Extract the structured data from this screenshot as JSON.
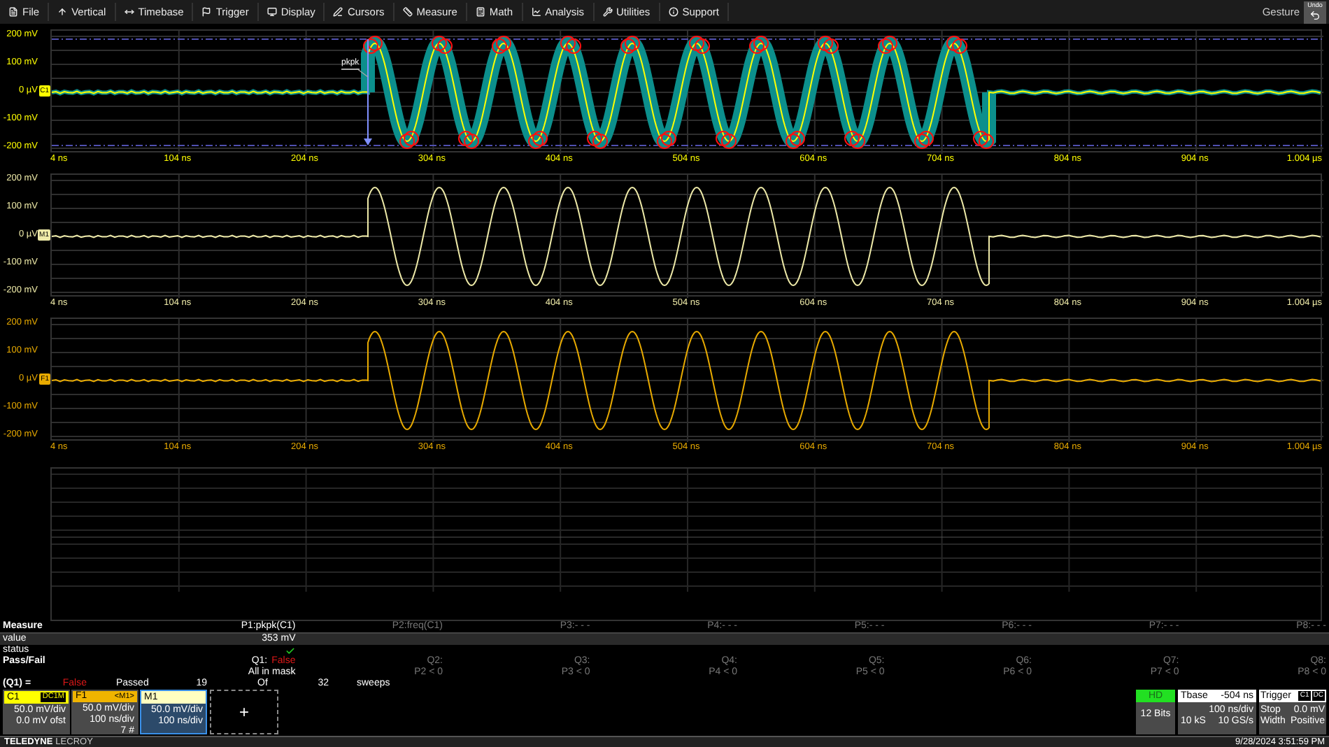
{
  "menu": [
    {
      "label": "File"
    },
    {
      "label": "Vertical"
    },
    {
      "label": "Timebase"
    },
    {
      "label": "Trigger"
    },
    {
      "label": "Display"
    },
    {
      "label": "Cursors"
    },
    {
      "label": "Measure"
    },
    {
      "label": "Math"
    },
    {
      "label": "Analysis"
    },
    {
      "label": "Utilities"
    },
    {
      "label": "Support"
    }
  ],
  "gesture": "Gesture",
  "undo": "Undo",
  "grids": [
    {
      "kind": "mask",
      "tag": "C1",
      "color": "#ffff00",
      "annotation": "pkpk",
      "y_labels": [
        "200 mV",
        "100 mV",
        "0 µV",
        "-100 mV",
        "-200 mV"
      ],
      "x_labels": [
        "4 ns",
        "104 ns",
        "204 ns",
        "304 ns",
        "404 ns",
        "504 ns",
        "604 ns",
        "704 ns",
        "804 ns",
        "904 ns",
        "1.004 µs"
      ]
    },
    {
      "kind": "trace",
      "tag": "M1",
      "color": "#eeeaa8",
      "y_labels": [
        "200 mV",
        "100 mV",
        "0 µV",
        "-100 mV",
        "-200 mV"
      ],
      "x_labels": [
        "4 ns",
        "104 ns",
        "204 ns",
        "304 ns",
        "404 ns",
        "504 ns",
        "604 ns",
        "704 ns",
        "804 ns",
        "904 ns",
        "1.004 µs"
      ]
    },
    {
      "kind": "trace",
      "tag": "F1",
      "color": "#e8aa00",
      "y_labels": [
        "200 mV",
        "100 mV",
        "0 µV",
        "-100 mV",
        "-200 mV"
      ],
      "x_labels": [
        "4 ns",
        "104 ns",
        "204 ns",
        "304 ns",
        "404 ns",
        "504 ns",
        "604 ns",
        "704 ns",
        "804 ns",
        "904 ns",
        "1.004 µs"
      ]
    },
    {
      "kind": "empty"
    }
  ],
  "measure": {
    "title": "Measure",
    "row_labels": [
      "value",
      "status",
      "Pass/Fail"
    ],
    "params": [
      {
        "label": "P1:pkpk(C1)",
        "active": true,
        "value": "353 mV",
        "status_ok": true,
        "q_label": "Q1:",
        "q_result": "False",
        "q_condition": "All in mask"
      },
      {
        "label": "P2:freq(C1)",
        "active": false,
        "q_label": "Q2:",
        "q_condition": "P2 < 0"
      },
      {
        "label": "P3:- - -",
        "active": false,
        "q_label": "Q3:",
        "q_condition": "P3 < 0"
      },
      {
        "label": "P4:- - -",
        "active": false,
        "q_label": "Q4:",
        "q_condition": "P4 < 0"
      },
      {
        "label": "P5:- - -",
        "active": false,
        "q_label": "Q5:",
        "q_condition": "P5 < 0"
      },
      {
        "label": "P6:- - -",
        "active": false,
        "q_label": "Q6:",
        "q_condition": "P6 < 0"
      },
      {
        "label": "P7:- - -",
        "active": false,
        "q_label": "Q7:",
        "q_condition": "P7 < 0"
      },
      {
        "label": "P8:- - -",
        "active": false,
        "q_label": "Q8:",
        "q_condition": "P8 < 0"
      }
    ]
  },
  "summary": {
    "label": "(Q1) =",
    "result": "False",
    "passed_label": "Passed",
    "passed": "19",
    "of_label": "Of",
    "total": "32",
    "unit": "sweeps"
  },
  "descriptors": [
    {
      "name": "C1",
      "badge": "DC1M",
      "badge_boxed": true,
      "color": "#ffff00",
      "selected": false,
      "lines": [
        "50.0 mV/div",
        "0.0 mV ofst"
      ]
    },
    {
      "name": "F1",
      "badge": "<M1>",
      "badge_boxed": false,
      "color": "#f0b400",
      "selected": false,
      "lines": [
        "50.0 mV/div",
        "100 ns/div",
        "7 #"
      ]
    },
    {
      "name": "M1",
      "color": "#ffffc0",
      "selected": true,
      "lines": [
        "50.0 mV/div",
        "100 ns/div"
      ]
    }
  ],
  "add_button": "+",
  "acquisition": {
    "mode": "HD",
    "resolution": "12 Bits"
  },
  "timebase": {
    "title": "Tbase",
    "delay": "-504 ns",
    "scale": "100 ns/div",
    "samples": "10 kS",
    "rate": "10 GS/s"
  },
  "trigger": {
    "title": "Trigger",
    "source": "C1",
    "coupling": "DC",
    "mode": "Stop",
    "threshold": "0.0 mV",
    "type": "Width",
    "slope": "Positive"
  },
  "brand": {
    "name": "TELEDYNE",
    "sub": "LECROY"
  },
  "datetime": "9/28/2024 3:51:59 PM"
}
